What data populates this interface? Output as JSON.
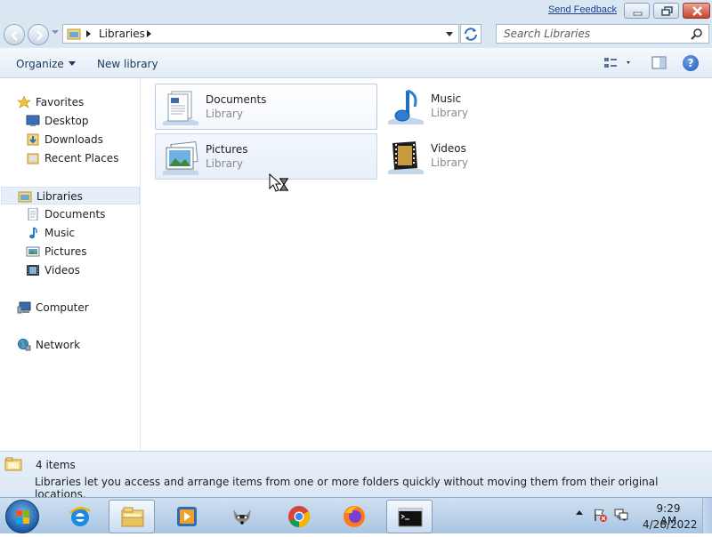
{
  "window": {
    "feedback_link": "Send Feedback"
  },
  "address": {
    "path": "Libraries",
    "search_placeholder": "Search Libraries"
  },
  "toolbar": {
    "organize_label": "Organize",
    "new_library_label": "New library"
  },
  "nav": {
    "favorites": {
      "label": "Favorites",
      "items": [
        "Desktop",
        "Downloads",
        "Recent Places"
      ]
    },
    "libraries": {
      "label": "Libraries",
      "items": [
        "Documents",
        "Music",
        "Pictures",
        "Videos"
      ]
    },
    "computer": "Computer",
    "network": "Network"
  },
  "content": {
    "tiles": [
      {
        "name": "Documents",
        "type": "Library",
        "icon": "documents-library-icon"
      },
      {
        "name": "Music",
        "type": "Library",
        "icon": "music-library-icon"
      },
      {
        "name": "Pictures",
        "type": "Library",
        "icon": "pictures-library-icon"
      },
      {
        "name": "Videos",
        "type": "Library",
        "icon": "videos-library-icon"
      }
    ]
  },
  "details": {
    "count": "4 items",
    "description": "Libraries let you access and arrange items from one or more folders quickly without moving them from their original locations."
  },
  "taskbar": {
    "apps": [
      "start-orb",
      "internet-explorer",
      "windows-explorer",
      "media-player",
      "raccoon-app",
      "chrome",
      "firefox",
      "command-prompt"
    ],
    "time": "9:29 AM",
    "date": "4/28/2022"
  }
}
